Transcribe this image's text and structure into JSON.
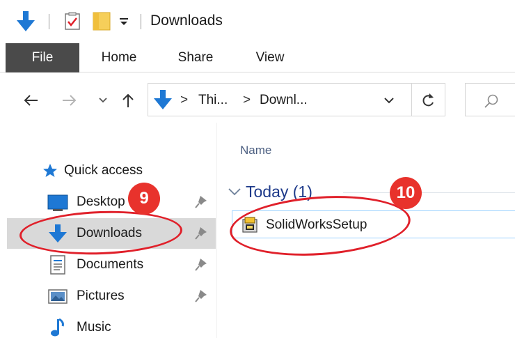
{
  "window": {
    "title": "Downloads",
    "quick_access_toolbar": [
      "down-arrow-icon",
      "properties-icon",
      "new-folder-icon",
      "dropdown-icon"
    ]
  },
  "ribbon": {
    "tabs": [
      {
        "label": "File",
        "active": true
      },
      {
        "label": "Home"
      },
      {
        "label": "Share"
      },
      {
        "label": "View"
      }
    ]
  },
  "address_bar": {
    "crumbs": [
      "Thi...",
      "Downl..."
    ],
    "separator": ">"
  },
  "navigation_pane": {
    "quick_access_label": "Quick access",
    "items": [
      {
        "label": "Desktop",
        "icon": "desktop-icon",
        "pinned": true
      },
      {
        "label": "Downloads",
        "icon": "downloads-icon",
        "pinned": true,
        "selected": true
      },
      {
        "label": "Documents",
        "icon": "documents-icon",
        "pinned": true
      },
      {
        "label": "Pictures",
        "icon": "pictures-icon",
        "pinned": true
      },
      {
        "label": "Music",
        "icon": "music-icon",
        "pinned": false
      }
    ]
  },
  "content": {
    "column_header": "Name",
    "group_label": "Today (1)",
    "files": [
      {
        "name": "SolidWorksSetup",
        "icon": "installer-icon"
      }
    ]
  },
  "annotations": {
    "badges": [
      "9",
      "10"
    ],
    "color": "#e8322c"
  },
  "colors": {
    "accent_blue": "#1e78d4",
    "file_tab": "#4a4a4a",
    "selected_item": "#d9d9d9",
    "group_header": "#1e3a8a"
  }
}
